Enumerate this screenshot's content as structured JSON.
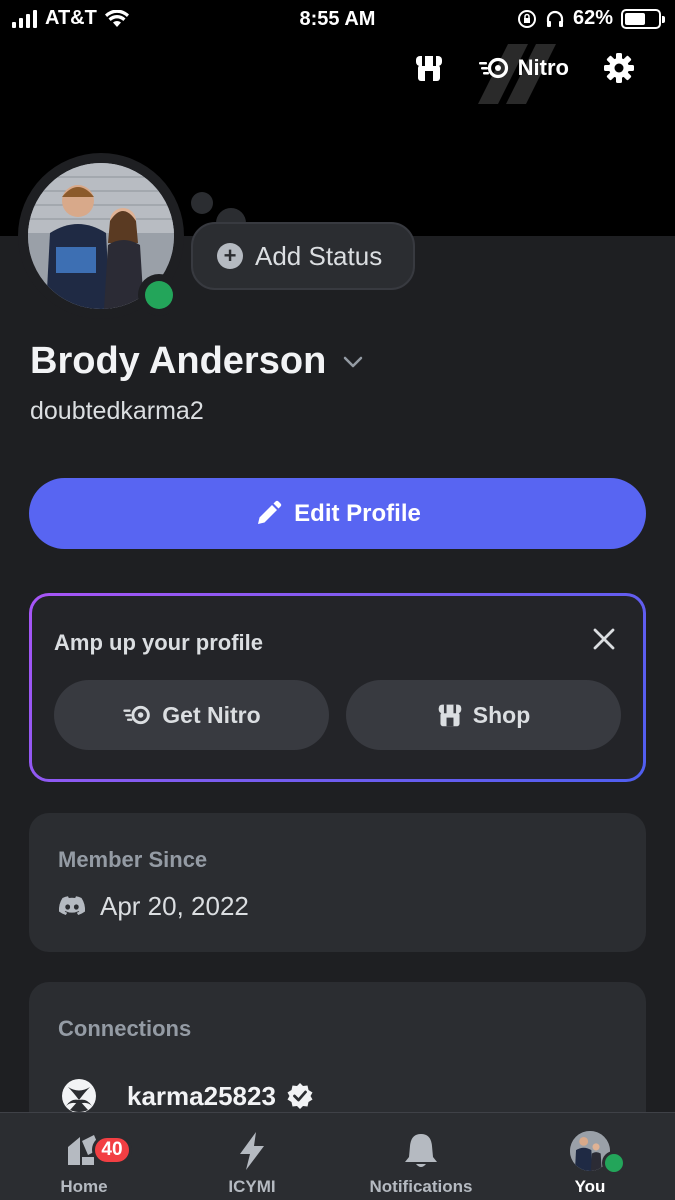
{
  "status_bar": {
    "carrier": "AT&T",
    "time": "8:55 AM",
    "battery": "62%",
    "battery_level": 0.62
  },
  "header": {
    "nitro_label": "Nitro",
    "icons": [
      "shop-icon",
      "nitro-icon",
      "gear-icon"
    ]
  },
  "profile": {
    "display_name": "Brody Anderson",
    "username": "doubtedkarma2",
    "add_status_label": "Add Status",
    "edit_profile_label": "Edit Profile",
    "online_color": "#23a55a"
  },
  "amp_card": {
    "title": "Amp up your profile",
    "get_nitro_label": "Get Nitro",
    "shop_label": "Shop"
  },
  "member_since": {
    "label": "Member Since",
    "date": "Apr 20, 2022"
  },
  "connections": {
    "label": "Connections",
    "items": [
      {
        "service": "xbox",
        "account": "karma25823",
        "verified": true
      }
    ]
  },
  "bottom_nav": {
    "items": [
      {
        "label": "Home",
        "badge": "40"
      },
      {
        "label": "ICYMI"
      },
      {
        "label": "Notifications"
      },
      {
        "label": "You"
      }
    ]
  },
  "colors": {
    "accent": "#5865f2",
    "background": "#1e1f22",
    "card": "#2b2d31",
    "badge": "#f23f43"
  }
}
